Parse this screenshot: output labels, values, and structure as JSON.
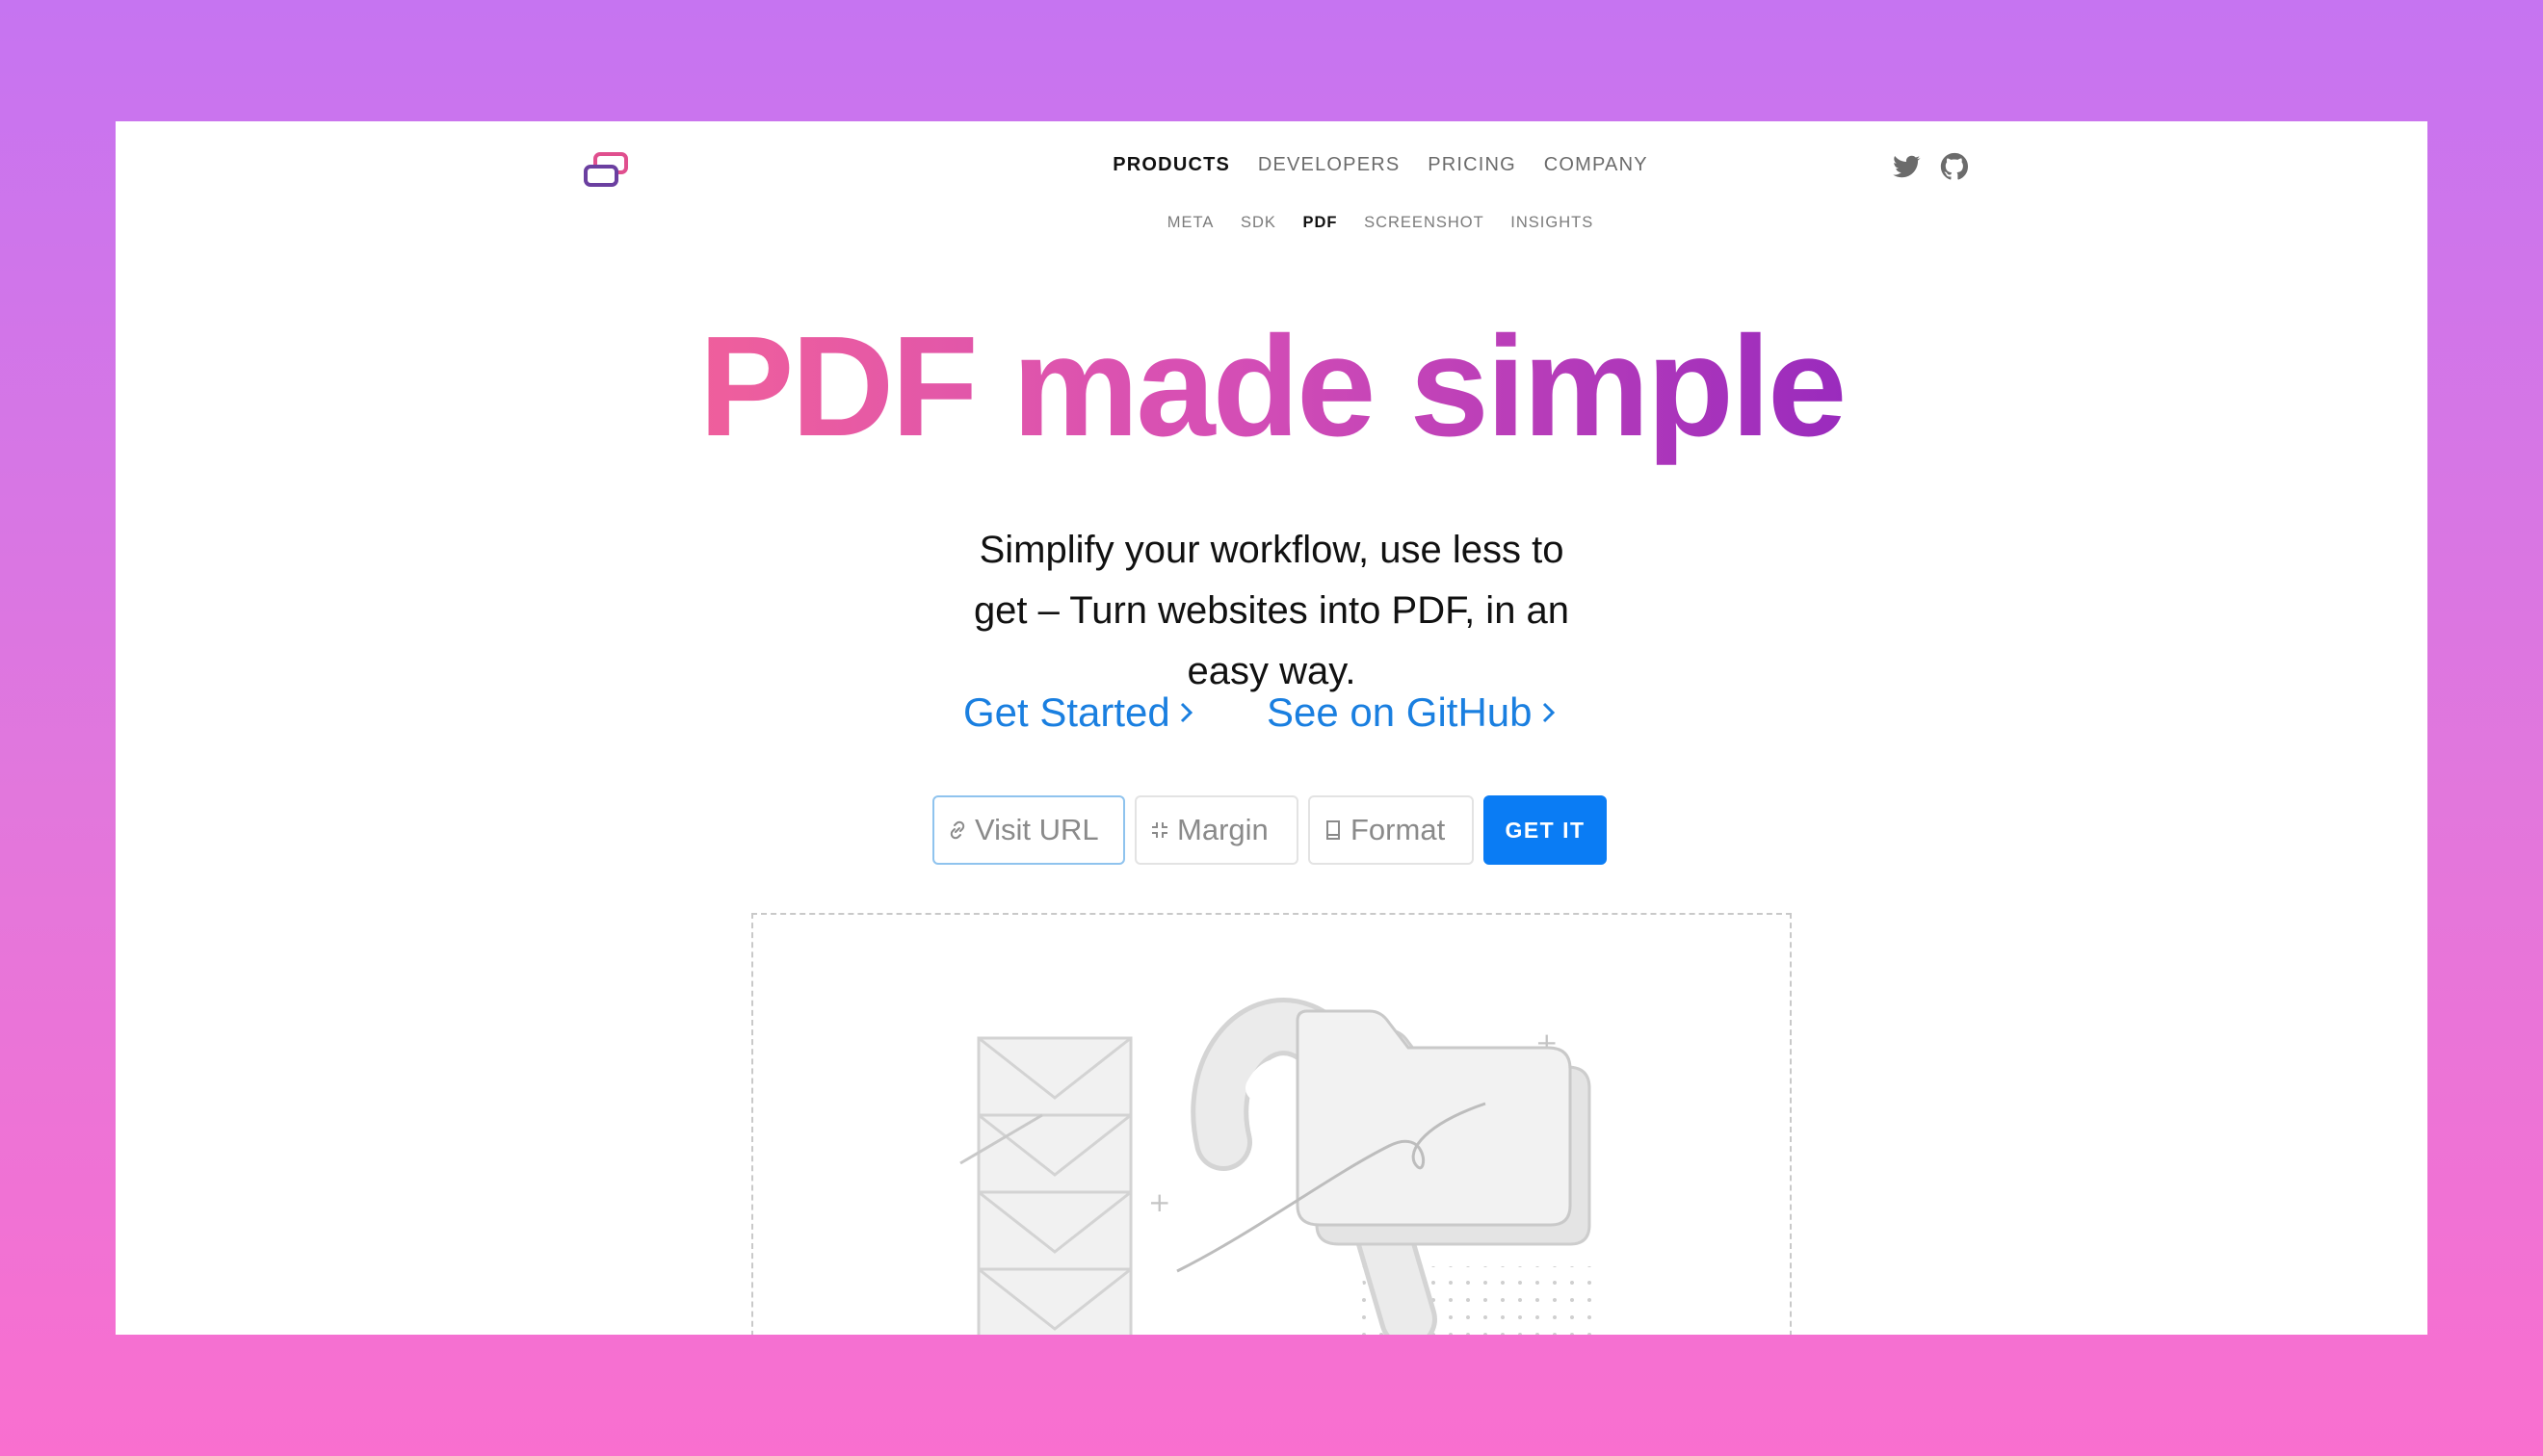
{
  "nav": {
    "main": [
      {
        "label": "PRODUCTS",
        "active": true
      },
      {
        "label": "DEVELOPERS",
        "active": false
      },
      {
        "label": "PRICING",
        "active": false
      },
      {
        "label": "COMPANY",
        "active": false
      }
    ],
    "sub": [
      {
        "label": "META",
        "active": false
      },
      {
        "label": "SDK",
        "active": false
      },
      {
        "label": "PDF",
        "active": true
      },
      {
        "label": "SCREENSHOT",
        "active": false
      },
      {
        "label": "INSIGHTS",
        "active": false
      }
    ],
    "social_icons": [
      "twitter-icon",
      "github-icon"
    ]
  },
  "hero": {
    "title": "PDF made simple",
    "subtitle": "Simplify your workflow, use less to get – Turn websites into PDF, in an easy way.",
    "cta_primary": "Get Started",
    "cta_secondary": "See on GitHub"
  },
  "form": {
    "url_placeholder": "Visit URL",
    "margin_placeholder": "Margin",
    "format_placeholder": "Format",
    "submit_label": "GET IT"
  },
  "colors": {
    "title_gradient_start": "#ef5f9c",
    "title_gradient_end": "#9a2bbd",
    "link": "#1a7fe0",
    "button": "#0a7cf4",
    "page_bg_top": "#c674f1",
    "page_bg_bottom": "#f96fcf"
  }
}
